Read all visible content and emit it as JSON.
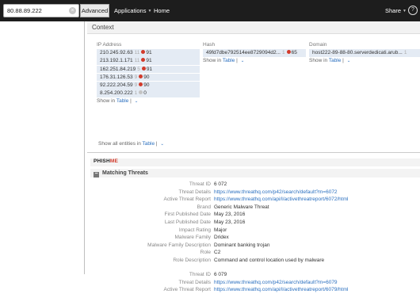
{
  "topbar": {
    "search_value": "80.88.89.222",
    "clear_symbol": "×",
    "advanced_label": "Advanced",
    "applications_label": "Applications",
    "home_label": "Home",
    "share_label": "Share",
    "help_symbol": "?"
  },
  "context": {
    "title": "Context",
    "ip": {
      "title": "IP Address",
      "rows": [
        {
          "value": "210.245.92.63",
          "count": "11",
          "score": "91",
          "dot": "red"
        },
        {
          "value": "213.192.1.171",
          "count": "11",
          "score": "91",
          "dot": "red"
        },
        {
          "value": "162.251.84.219",
          "count": "5",
          "score": "91",
          "dot": "red"
        },
        {
          "value": "176.31.126.53",
          "count": "9",
          "score": "90",
          "dot": "red"
        },
        {
          "value": "92.222.204.59",
          "count": "9",
          "score": "90",
          "dot": "red"
        },
        {
          "value": "8.254.200.222",
          "count": "1",
          "score": "0",
          "dot": "grey"
        }
      ],
      "show_in_prefix": "Show in ",
      "show_in_link": "Table",
      "show_in_sep": " | ",
      "chev": "⌄"
    },
    "hash": {
      "title": "Hash",
      "rows": [
        {
          "value": "49fd7dbe792514ee8729094d2...",
          "count": "1",
          "score": "65",
          "dot": "red"
        }
      ],
      "show_in_prefix": "Show in ",
      "show_in_link": "Table",
      "show_in_sep": " | ",
      "chev": "⌄"
    },
    "domain": {
      "title": "Domain",
      "rows": [
        {
          "value": "host222-89-88-80.serverdedicati.arub...",
          "count": "1",
          "score": "",
          "dot": ""
        }
      ],
      "show_in_prefix": "Show in ",
      "show_in_link": "Table",
      "show_in_sep": " | ",
      "chev": "⌄"
    },
    "show_all_prefix": "Show all entities in ",
    "show_all_link": "Table",
    "show_all_sep": " | ",
    "show_all_chev": "⌄"
  },
  "brand": {
    "part_a": "PHISH",
    "part_b": "ME"
  },
  "matching": {
    "title": "Matching Threats",
    "minus": "−",
    "threats": [
      {
        "rows": [
          {
            "label": "Threat ID",
            "value": "6 072",
            "link": false
          },
          {
            "label": "Threat Details",
            "value": "https://www.threathq.com/p42/search/default?m=6072",
            "link": true
          },
          {
            "label": "Active Threat Report",
            "value": "https://www.threathq.com/api/l/activethreatreport/6072/html",
            "link": true
          },
          {
            "label": "Brand",
            "value": "Generic Malware Threat",
            "link": false
          },
          {
            "label": "First Published Date",
            "value": "May 23, 2016",
            "link": false
          },
          {
            "label": "Last Published Date",
            "value": "May 23, 2016",
            "link": false
          },
          {
            "label": "Impact Rating",
            "value": "Major",
            "link": false
          },
          {
            "label": "Malware Family",
            "value": "Dridex",
            "link": false
          },
          {
            "label": "Malware Family Description",
            "value": "Dominant banking trojan",
            "link": false
          },
          {
            "label": "Role",
            "value": "C2",
            "link": false
          },
          {
            "label": "Role Description",
            "value": "Command and control location used by malware",
            "link": false
          }
        ]
      },
      {
        "rows": [
          {
            "label": "Threat ID",
            "value": "6 079",
            "link": false
          },
          {
            "label": "Threat Details",
            "value": "https://www.threathq.com/p42/search/default?m=6079",
            "link": true
          },
          {
            "label": "Active Threat Report",
            "value": "https://www.threathq.com/api/l/activethreatreport/6079/html",
            "link": true
          }
        ]
      }
    ]
  },
  "colors": {
    "accent_link": "#2a6fbf",
    "dot_red": "#d23a2a",
    "topbar_bg": "#1d1d1d"
  }
}
